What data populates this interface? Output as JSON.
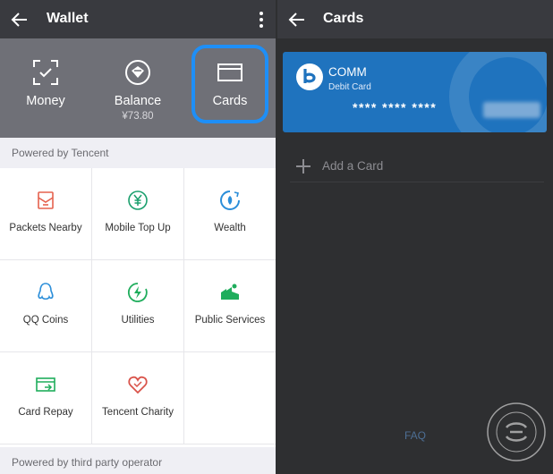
{
  "wallet": {
    "title": "Wallet",
    "hero": {
      "money_label": "Money",
      "balance_label": "Balance",
      "balance_value": "¥73.80",
      "cards_label": "Cards"
    },
    "section1_label": "Powered by Tencent",
    "services": [
      {
        "label": "Packets Nearby",
        "icon": "red-packet-icon",
        "color": "#e5624e"
      },
      {
        "label": "Mobile Top Up",
        "icon": "yuan-icon",
        "color": "#1a9f6d"
      },
      {
        "label": "Wealth",
        "icon": "wealth-icon",
        "color": "#2b8ed9"
      },
      {
        "label": "QQ Coins",
        "icon": "penguin-icon",
        "color": "#2b8ed9"
      },
      {
        "label": "Utilities",
        "icon": "lightning-icon",
        "color": "#1fad5c"
      },
      {
        "label": "Public Services",
        "icon": "city-icon",
        "color": "#1fad5c"
      },
      {
        "label": "Card Repay",
        "icon": "card-repay-icon",
        "color": "#1fad5c"
      },
      {
        "label": "Tencent Charity",
        "icon": "heart-icon",
        "color": "#d9534a"
      }
    ],
    "section2_label": "Powered by third party operator"
  },
  "cards": {
    "title": "Cards",
    "card": {
      "bank": "COMM",
      "type": "Debit Card",
      "number": "**** **** ****",
      "color": "#1f73be"
    },
    "add_card_label": "Add a Card",
    "faq_label": "FAQ"
  }
}
